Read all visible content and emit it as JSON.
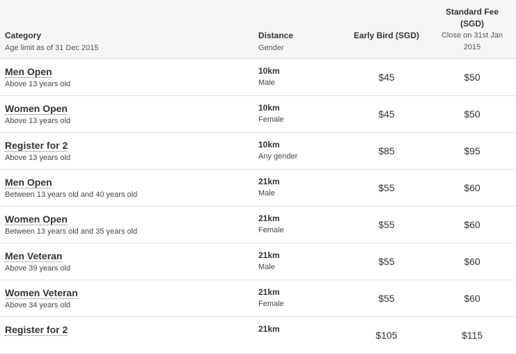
{
  "header": {
    "category": "Category",
    "age_limit": "Age limit as of 31 Dec 2015",
    "distance": "Distance",
    "gender": "Gender",
    "early_bird": "Early Bird (SGD)",
    "standard_fee_line1": "Standard Fee",
    "standard_fee_line2": "(SGD)",
    "close_line1": "Close on 31st Jan",
    "close_line2": "2015"
  },
  "rows": [
    {
      "name": "Men Open",
      "desc": "Above 13 years old",
      "distance": "10km",
      "gender": "Male",
      "early": "$45",
      "standard": "$50"
    },
    {
      "name": "Women Open",
      "desc": "Above 13 years old",
      "distance": "10km",
      "gender": "Female",
      "early": "$45",
      "standard": "$50"
    },
    {
      "name": "Register for 2",
      "desc": "Above 13 years old",
      "distance": "10km",
      "gender": "Any gender",
      "early": "$85",
      "standard": "$95"
    },
    {
      "name": "Men Open",
      "desc": "Between 13 years old and 40 years old",
      "distance": "21km",
      "gender": "Male",
      "early": "$55",
      "standard": "$60"
    },
    {
      "name": "Women Open",
      "desc": "Between 13 years old and 35 years old",
      "distance": "21km",
      "gender": "Female",
      "early": "$55",
      "standard": "$60"
    },
    {
      "name": "Men Veteran",
      "desc": "Above 39 years old",
      "distance": "21km",
      "gender": "Male",
      "early": "$55",
      "standard": "$60"
    },
    {
      "name": "Women Veteran",
      "desc": "Above 34 years old",
      "distance": "21km",
      "gender": "Female",
      "early": "$55",
      "standard": "$60"
    },
    {
      "name": "Register for 2",
      "desc": "",
      "distance": "21km",
      "gender": "",
      "early": "$105",
      "standard": "$115"
    }
  ]
}
